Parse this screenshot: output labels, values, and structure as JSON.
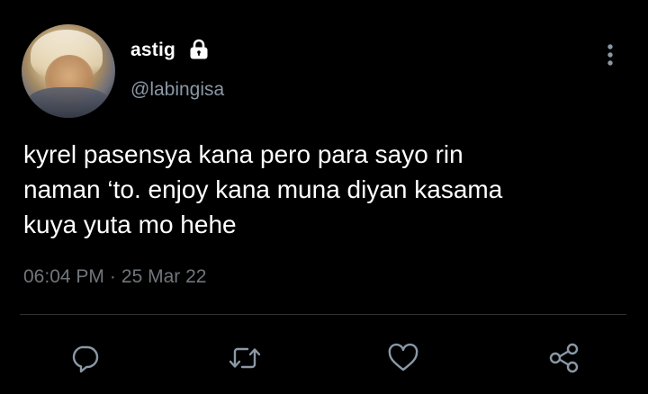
{
  "tweet": {
    "display_name": "astig",
    "handle": "@labingisa",
    "text": "kyrel pasensya kana pero para sayo rin\nnaman ‘to. enjoy kana muna diyan kasama\nkuya yuta mo hehe",
    "time": "06:04 PM",
    "separator": "·",
    "date": "25 Mar 22",
    "protected_icon": "lock-icon",
    "menu_icon": "more-vertical-icon"
  },
  "actions": [
    {
      "name": "reply",
      "icon": "reply-icon"
    },
    {
      "name": "retweet",
      "icon": "retweet-icon"
    },
    {
      "name": "like",
      "icon": "heart-icon"
    },
    {
      "name": "share",
      "icon": "share-icon"
    }
  ],
  "colors": {
    "background": "#000000",
    "primary_text": "#ffffff",
    "secondary_text": "#8b98a5",
    "meta_text": "#71767b",
    "icon": "#8b98a5",
    "divider": "#2f3336"
  }
}
